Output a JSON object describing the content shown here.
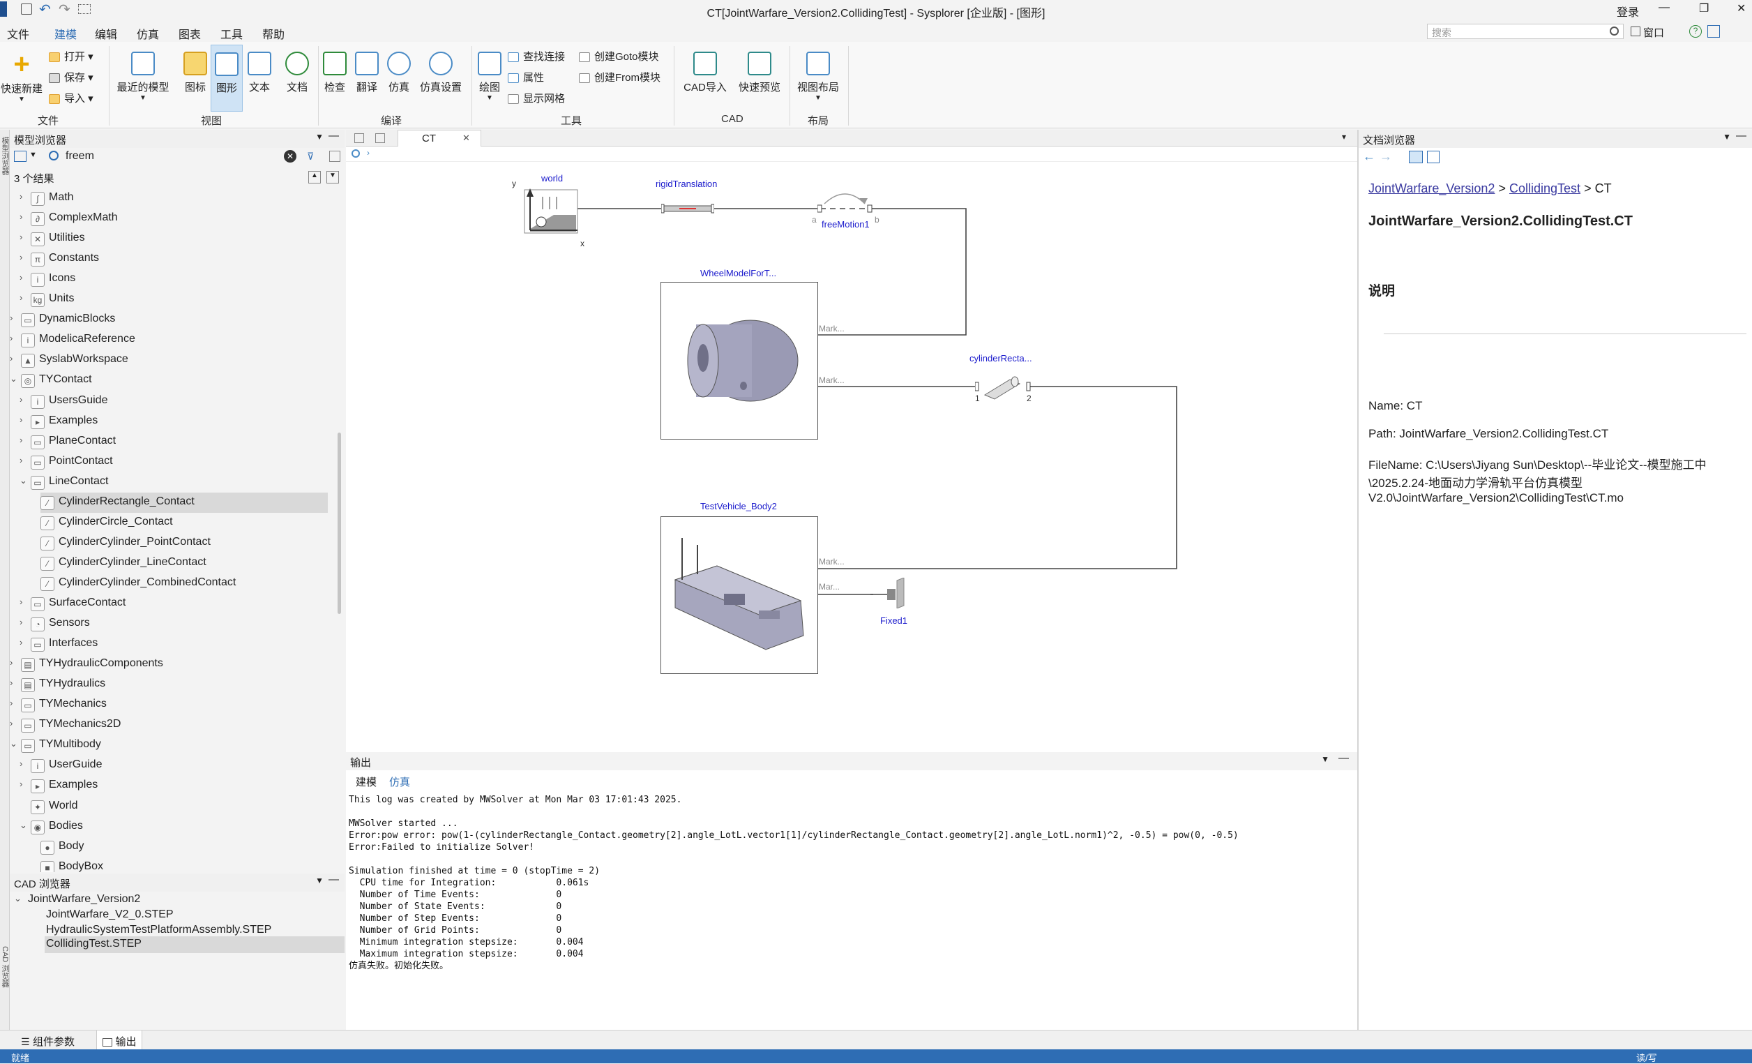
{
  "window": {
    "title": "CT[JointWarfare_Version2.CollidingTest] - Sysplorer [企业版] - [图形]",
    "login": "登录",
    "min": "—",
    "restore": "❐",
    "close": "✕"
  },
  "quick": {
    "undo": "↶",
    "redo": "↷"
  },
  "menu": [
    "文件",
    "建模",
    "编辑",
    "仿真",
    "图表",
    "工具",
    "帮助"
  ],
  "search": {
    "placeholder": "搜索",
    "window_label": "窗口"
  },
  "ribbon": {
    "file": {
      "new": "快速新建",
      "open": "打开",
      "save": "保存",
      "import": "导入",
      "group": "文件"
    },
    "view": {
      "recent": "最近的模型",
      "icon": "图标",
      "diagram": "图形",
      "text": "文本",
      "doc": "文档",
      "group": "视图"
    },
    "compile": {
      "check": "检查",
      "translate": "翻译",
      "simulate": "仿真",
      "settings": "仿真设置",
      "group": "编译"
    },
    "tools": {
      "draw": "绘图",
      "find": "查找连接",
      "props": "属性",
      "grid": "显示网格",
      "goto": "创建Goto模块",
      "from": "创建From模块",
      "group": "工具"
    },
    "cad": {
      "import": "CAD导入",
      "preview": "快速预览",
      "group": "CAD"
    },
    "layout": {
      "layout": "视图布局",
      "group": "布局"
    }
  },
  "model_browser": {
    "title": "模型浏览器",
    "search_value": "freem",
    "results": "3 个结果",
    "items": [
      {
        "label": "Math",
        "icon": "∫",
        "level": 1,
        "expanded": false
      },
      {
        "label": "ComplexMath",
        "icon": "∂",
        "level": 1,
        "expanded": false
      },
      {
        "label": "Utilities",
        "icon": "✕",
        "level": 1,
        "expanded": false
      },
      {
        "label": "Constants",
        "icon": "π",
        "level": 1,
        "expanded": false
      },
      {
        "label": "Icons",
        "icon": "i",
        "level": 1,
        "expanded": false
      },
      {
        "label": "Units",
        "icon": "kg",
        "level": 1,
        "expanded": false
      },
      {
        "label": "DynamicBlocks",
        "icon": "▭",
        "level": 0,
        "expanded": false
      },
      {
        "label": "ModelicaReference",
        "icon": "i",
        "level": 0,
        "expanded": false
      },
      {
        "label": "SyslabWorkspace",
        "icon": "▲",
        "level": 0,
        "expanded": false
      },
      {
        "label": "TYContact",
        "icon": "◎",
        "level": 0,
        "expanded": true
      },
      {
        "label": "UsersGuide",
        "icon": "i",
        "level": 1,
        "expanded": false
      },
      {
        "label": "Examples",
        "icon": "▸",
        "level": 1,
        "expanded": false
      },
      {
        "label": "PlaneContact",
        "icon": "▭",
        "level": 1,
        "expanded": false
      },
      {
        "label": "PointContact",
        "icon": "▭",
        "level": 1,
        "expanded": false
      },
      {
        "label": "LineContact",
        "icon": "▭",
        "level": 1,
        "expanded": true
      },
      {
        "label": "CylinderRectangle_Contact",
        "icon": "⁄",
        "level": 2,
        "selected": true
      },
      {
        "label": "CylinderCircle_Contact",
        "icon": "⁄",
        "level": 2
      },
      {
        "label": "CylinderCylinder_PointContact",
        "icon": "⁄",
        "level": 2
      },
      {
        "label": "CylinderCylinder_LineContact",
        "icon": "⁄",
        "level": 2
      },
      {
        "label": "CylinderCylinder_CombinedContact",
        "icon": "⁄",
        "level": 2
      },
      {
        "label": "SurfaceContact",
        "icon": "▭",
        "level": 1,
        "expanded": false
      },
      {
        "label": "Sensors",
        "icon": "◔",
        "level": 1,
        "expanded": false
      },
      {
        "label": "Interfaces",
        "icon": "▭",
        "level": 1,
        "expanded": false
      },
      {
        "label": "TYHydraulicComponents",
        "icon": "▤",
        "level": 0,
        "expanded": false
      },
      {
        "label": "TYHydraulics",
        "icon": "▤",
        "level": 0,
        "expanded": false
      },
      {
        "label": "TYMechanics",
        "icon": "▭",
        "level": 0,
        "expanded": false
      },
      {
        "label": "TYMechanics2D",
        "icon": "▭",
        "level": 0,
        "expanded": false
      },
      {
        "label": "TYMultibody",
        "icon": "▭",
        "level": 0,
        "expanded": true
      },
      {
        "label": "UserGuide",
        "icon": "i",
        "level": 1,
        "expanded": false
      },
      {
        "label": "Examples",
        "icon": "▸",
        "level": 1,
        "expanded": false
      },
      {
        "label": "World",
        "icon": "✦",
        "level": 1,
        "leaf": true
      },
      {
        "label": "Bodies",
        "icon": "◉",
        "level": 1,
        "expanded": true
      },
      {
        "label": "Body",
        "icon": "●",
        "level": 2
      },
      {
        "label": "BodyBox",
        "icon": "■",
        "level": 2
      }
    ]
  },
  "cad_browser": {
    "title": "CAD 浏览器",
    "root": "JointWarfare_Version2",
    "items": [
      "JointWarfare_V2_0.STEP",
      "HydraulicSystemTestPlatformAssembly.STEP",
      "CollidingTest.STEP"
    ]
  },
  "side_tabs": {
    "left_top": "模型浏览器",
    "left_bottom": "CAD 浏览器"
  },
  "editor": {
    "tab": "CT",
    "tab_close": "✕",
    "blocks": {
      "world": "world",
      "rigid": "rigidTranslation",
      "free": "freeMotion1",
      "wheel": "WheelModelForT...",
      "cyl": "cylinderRecta...",
      "vehicle": "TestVehicle_Body2",
      "fixed": "Fixed1",
      "mark": "Mark...",
      "mar": "Mar...",
      "a": "a",
      "b": "b",
      "p1": "1",
      "p2": "2",
      "y": "y",
      "x": "x"
    }
  },
  "output": {
    "title": "输出",
    "tabs": [
      "建模",
      "仿真"
    ],
    "active_tab": 1,
    "log": "This log was created by MWSolver at Mon Mar 03 17:01:43 2025.\n\nMWSolver started ...\nError:pow error: pow(1-(cylinderRectangle_Contact.geometry[2].angle_LotL.vector1[1]/cylinderRectangle_Contact.geometry[2].angle_LotL.norm1)^2, -0.5) = pow(0, -0.5)\nError:Failed to initialize Solver!\n\nSimulation finished at time = 0 (stopTime = 2)\n  CPU time for Integration:           0.061s\n  Number of Time Events:              0\n  Number of State Events:             0\n  Number of Step Events:              0\n  Number of Grid Points:              0\n  Minimum integration stepsize:       0.004\n  Maximum integration stepsize:       0.004\n仿真失败。初始化失败。"
  },
  "doc_browser": {
    "title": "文档浏览器",
    "crumb1": "JointWarfare_Version2",
    "sep": ">",
    "crumb2": "CollidingTest",
    "crumb3": "CT",
    "heading": "JointWarfare_Version2.CollidingTest.CT",
    "desc_title": "说明",
    "name": "Name: CT",
    "path": "Path: JointWarfare_Version2.CollidingTest.CT",
    "file1": "FileName: C:\\Users\\Jiyang Sun\\Desktop\\--毕业论文--模型施工中",
    "file2": "\\2025.2.24-地面动力学滑轨平台仿真模型",
    "file3": "V2.0\\JointWarfare_Version2\\CollidingTest\\CT.mo"
  },
  "bottom_tabs": {
    "params": "组件参数",
    "output": "输出"
  },
  "status": {
    "left": "就绪",
    "right": "读/写"
  }
}
